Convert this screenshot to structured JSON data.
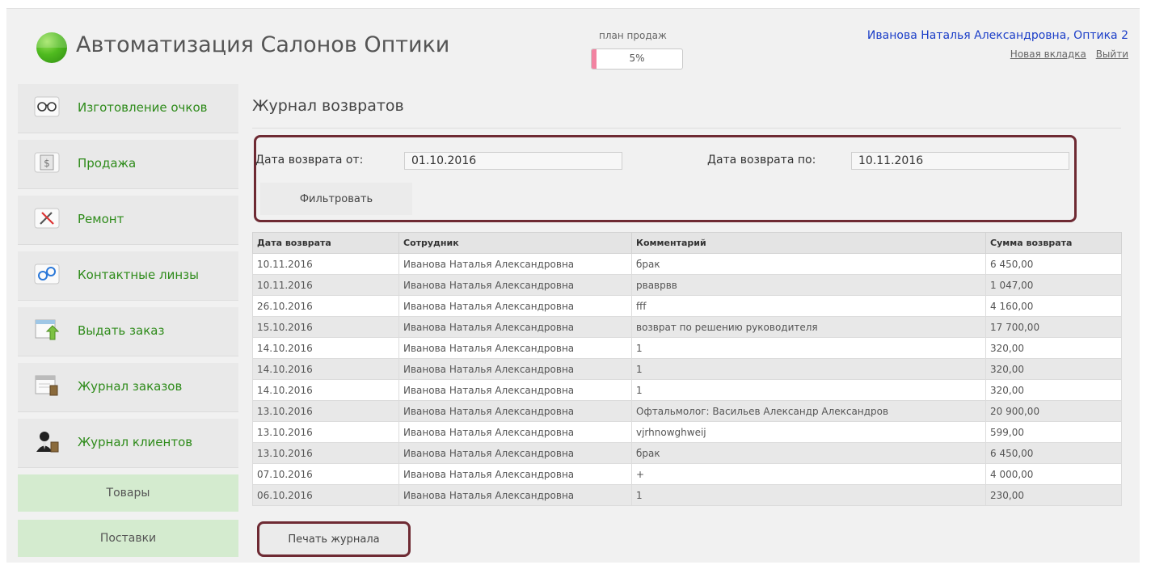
{
  "header": {
    "app_title": "Автоматизация Салонов Оптики",
    "plan_label": "план продаж",
    "plan_value": "5%",
    "plan_progress": 0.05,
    "user_name": "Иванова Наталья Александровна, Оптика 2",
    "new_tab_link": "Новая вкладка",
    "logout_link": "Выйти"
  },
  "sidebar": {
    "items": [
      {
        "label": "Изготовление очков",
        "icon": "glasses-icon"
      },
      {
        "label": "Продажа",
        "icon": "cash-icon"
      },
      {
        "label": "Ремонт",
        "icon": "repair-icon"
      },
      {
        "label": "Контактные линзы",
        "icon": "contact-lens-icon"
      },
      {
        "label": "Выдать заказ",
        "icon": "issue-order-icon"
      },
      {
        "label": "Журнал заказов",
        "icon": "orders-journal-icon"
      },
      {
        "label": "Журнал клиентов",
        "icon": "clients-journal-icon"
      }
    ],
    "green_items": [
      "Товары",
      "Поставки"
    ]
  },
  "main": {
    "title": "Журнал возвратов",
    "filter": {
      "from_label": "Дата возврата от:",
      "from_value": "01.10.2016",
      "to_label": "Дата возврата по:",
      "to_value": "10.11.2016",
      "button_label": "Фильтровать"
    },
    "table": {
      "columns": [
        "Дата возврата",
        "Сотрудник",
        "Комментарий",
        "Сумма возврата"
      ],
      "rows": [
        [
          "10.11.2016",
          "Иванова Наталья Александровна",
          "брак",
          "6 450,00"
        ],
        [
          "10.11.2016",
          "Иванова Наталья Александровна",
          "рваврвв",
          "1 047,00"
        ],
        [
          "26.10.2016",
          "Иванова Наталья Александровна",
          "fff",
          "4 160,00"
        ],
        [
          "15.10.2016",
          "Иванова Наталья Александровна",
          "возврат по решению руководителя",
          "17 700,00"
        ],
        [
          "14.10.2016",
          "Иванова Наталья Александровна",
          "1",
          "320,00"
        ],
        [
          "14.10.2016",
          "Иванова Наталья Александровна",
          "1",
          "320,00"
        ],
        [
          "14.10.2016",
          "Иванова Наталья Александровна",
          "1",
          "320,00"
        ],
        [
          "13.10.2016",
          "Иванова Наталья Александровна",
          "Офтальмолог: Васильев Александр Александров",
          "20 900,00"
        ],
        [
          "13.10.2016",
          "Иванова Наталья Александровна",
          "vjrhnowghweij",
          "599,00"
        ],
        [
          "13.10.2016",
          "Иванова Наталья Александровна",
          "брак",
          "6 450,00"
        ],
        [
          "07.10.2016",
          "Иванова Наталья Александровна",
          "+",
          "4 000,00"
        ],
        [
          "06.10.2016",
          "Иванова Наталья Александровна",
          "1",
          "230,00"
        ]
      ]
    },
    "print_button": "Печать журнала"
  },
  "colors": {
    "brand_green": "#2e8b1a",
    "highlight_border": "#6e2a33",
    "user_link": "#1b3ec8",
    "progress_fill": "#f283a1"
  }
}
